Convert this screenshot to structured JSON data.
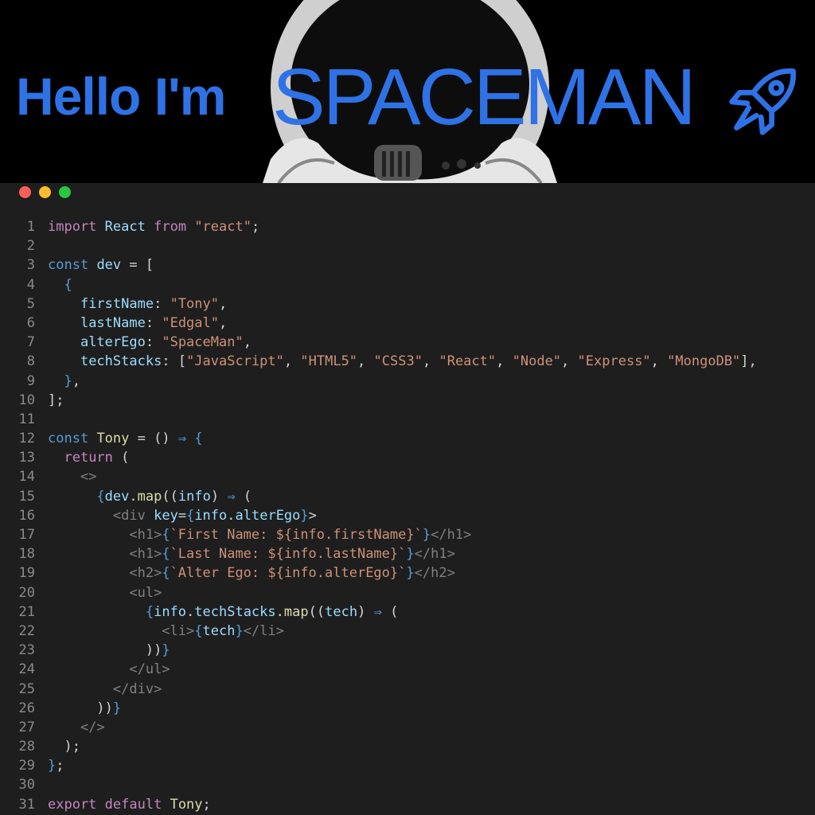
{
  "banner": {
    "greeting": "Hello I'm",
    "name": "SPACEMAN",
    "accent_color": "#2e72e6",
    "icons": [
      "astronaut-helmet-image",
      "rocket-icon"
    ]
  },
  "window": {
    "controls": [
      "close",
      "minimize",
      "maximize"
    ],
    "control_colors": [
      "#ff5f57",
      "#febc2e",
      "#28c840"
    ]
  },
  "editor": {
    "lines": [
      {
        "n": "1",
        "t": "import React from \"react\";"
      },
      {
        "n": "2",
        "t": ""
      },
      {
        "n": "3",
        "t": "const dev = ["
      },
      {
        "n": "4",
        "t": "  {"
      },
      {
        "n": "5",
        "t": "    firstName: \"Tony\","
      },
      {
        "n": "6",
        "t": "    lastName: \"Edgal\","
      },
      {
        "n": "7",
        "t": "    alterEgo: \"SpaceMan\","
      },
      {
        "n": "8",
        "t": "    techStacks: [\"JavaScript\", \"HTML5\", \"CSS3\", \"React\", \"Node\", \"Express\", \"MongoDB\"],"
      },
      {
        "n": "9",
        "t": "  },"
      },
      {
        "n": "10",
        "t": "];"
      },
      {
        "n": "11",
        "t": ""
      },
      {
        "n": "12",
        "t": "const Tony = () ⇒ {"
      },
      {
        "n": "13",
        "t": "  return ("
      },
      {
        "n": "14",
        "t": "    <>"
      },
      {
        "n": "15",
        "t": "      {dev.map((info) ⇒ ("
      },
      {
        "n": "16",
        "t": "        <div key={info.alterEgo}>"
      },
      {
        "n": "17",
        "t": "          <h1>{`First Name: ${info.firstName}`}</h1>"
      },
      {
        "n": "18",
        "t": "          <h1>{`Last Name: ${info.lastName}`}</h1>"
      },
      {
        "n": "19",
        "t": "          <h2>{`Alter Ego: ${info.alterEgo}`}</h2>"
      },
      {
        "n": "20",
        "t": "          <ul>"
      },
      {
        "n": "21",
        "t": "            {info.techStacks.map((tech) ⇒ ("
      },
      {
        "n": "22",
        "t": "              <li>{tech}</li>"
      },
      {
        "n": "23",
        "t": "            ))}"
      },
      {
        "n": "24",
        "t": "          </ul>"
      },
      {
        "n": "25",
        "t": "        </div>"
      },
      {
        "n": "26",
        "t": "      ))}"
      },
      {
        "n": "27",
        "t": "    </>"
      },
      {
        "n": "28",
        "t": "  );"
      },
      {
        "n": "29",
        "t": "};"
      },
      {
        "n": "30",
        "t": ""
      },
      {
        "n": "31",
        "t": "export default Tony;"
      }
    ]
  }
}
